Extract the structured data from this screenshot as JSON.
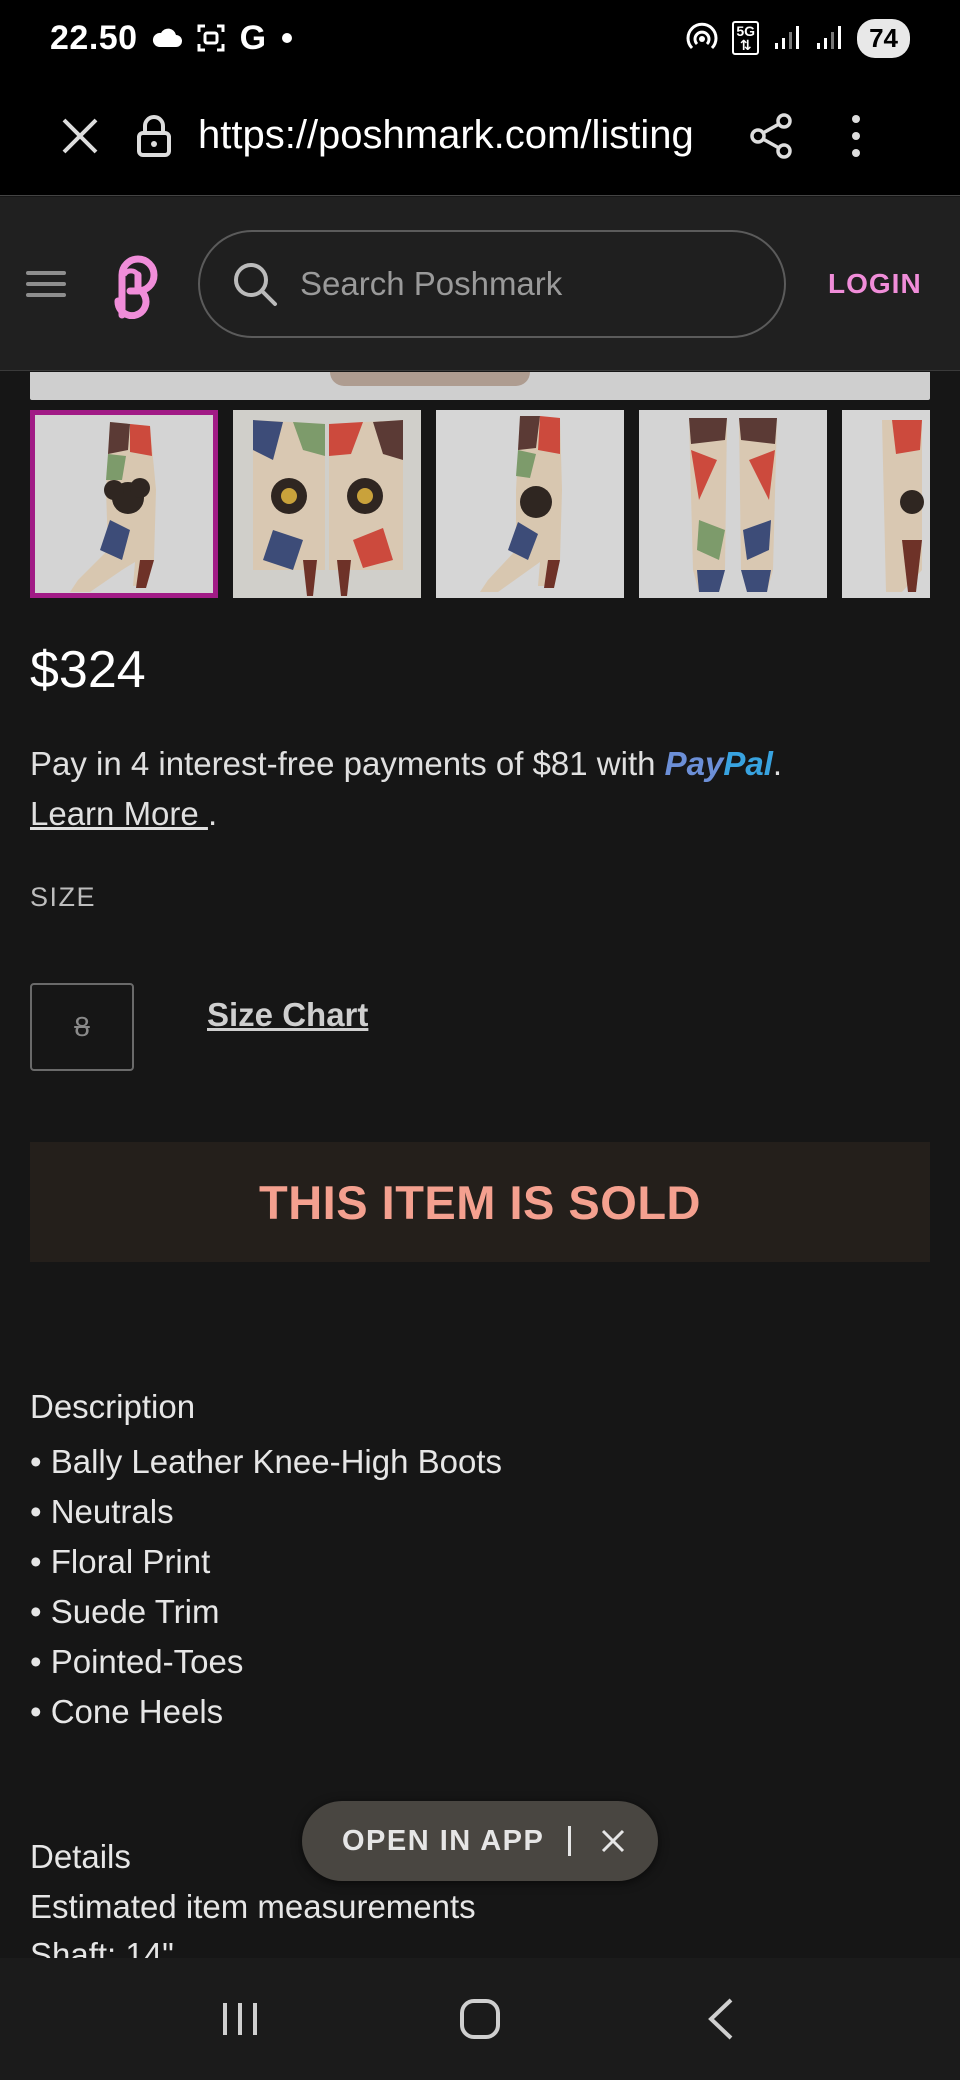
{
  "status_bar": {
    "time": "22.50",
    "carrier_letter": "G",
    "network": "5G",
    "battery": "74"
  },
  "browser": {
    "url": "https://poshmark.com/listing"
  },
  "header": {
    "search_placeholder": "Search Poshmark",
    "login_label": "LOGIN"
  },
  "listing": {
    "price": "$324",
    "paypal_text": "Pay in 4 interest-free payments of $81 with ",
    "paypal_brand_pay": "Pay",
    "paypal_brand_pal": "Pal",
    "paypal_period": ".",
    "learn_more": "Learn More ",
    "learn_more_period": ".",
    "size_label": "SIZE",
    "size_value": "8",
    "size_chart": "Size Chart",
    "sold_banner": "THIS ITEM IS SOLD",
    "description_heading": "Description",
    "description_items": [
      "• Bally Leather Knee-High Boots",
      "• Neutrals",
      "• Floral Print",
      "• Suede Trim",
      "• Pointed-Toes",
      "• Cone Heels"
    ],
    "details_heading": "Details",
    "details_line1": "Estimated item measurements",
    "details_line2": "Shaft: 14\""
  },
  "open_app": {
    "label": "OPEN IN APP"
  },
  "colors": {
    "accent_pink": "#f08dd9",
    "sold_text": "#f4a08f",
    "thumb_selected": "#a11b86"
  }
}
